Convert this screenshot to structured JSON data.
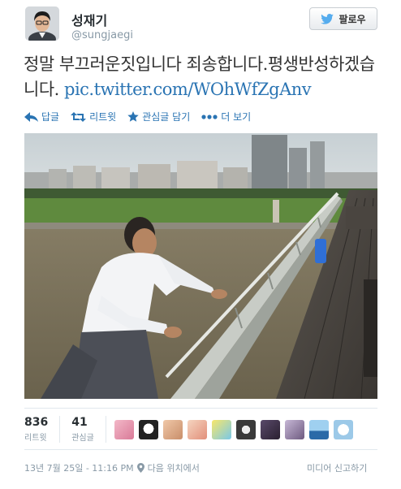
{
  "user": {
    "name": "성재기",
    "handle": "@sungjaegi"
  },
  "follow_button": {
    "label": "팔로우",
    "icon": "twitter-bird-icon"
  },
  "tweet": {
    "text": "정말 부끄러운짓입니다 죄송합니다.평생반성하겠습니다.",
    "link": "pic.twitter.com/WOhWfZgAnv"
  },
  "actions": {
    "reply": "답글",
    "retweet": "리트윗",
    "favorite": "관심글 담기",
    "more": "더 보기"
  },
  "stats": {
    "retweets": {
      "count": "836",
      "label": "리트윗"
    },
    "favorites": {
      "count": "41",
      "label": "관심글"
    }
  },
  "footer": {
    "timestamp": "13년 7월 25일 - 11:16 PM",
    "location": "다음 위치에서",
    "report": "미디어 신고하기"
  },
  "colors": {
    "link": "#2a74b3",
    "muted": "#8899a6",
    "twitter_blue": "#55acee"
  }
}
